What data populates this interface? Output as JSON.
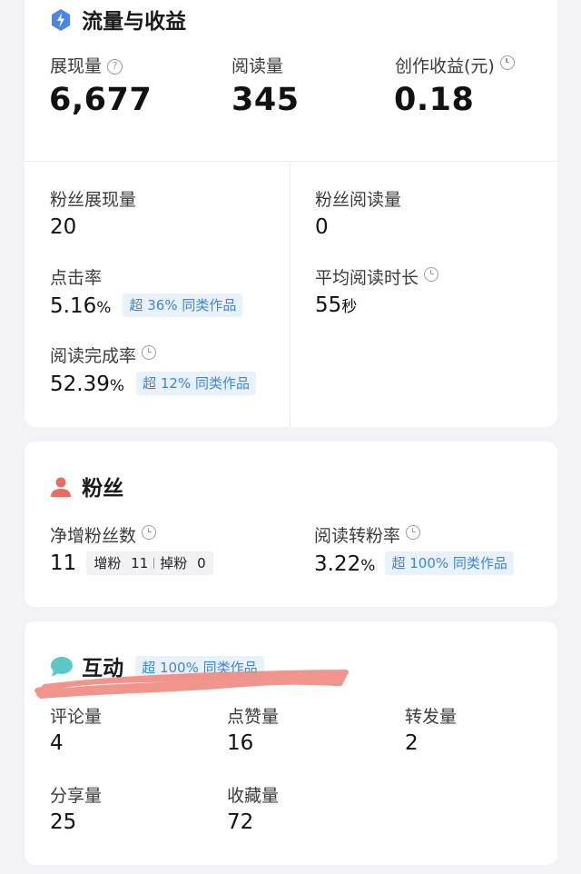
{
  "traffic": {
    "title": "流量与收益",
    "impressions": {
      "label": "展现量",
      "value": "6,677"
    },
    "reads": {
      "label": "阅读量",
      "value": "345"
    },
    "earnings": {
      "label": "创作收益(元)",
      "value": "0.18"
    },
    "fan_impressions": {
      "label": "粉丝展现量",
      "value": "20"
    },
    "fan_reads": {
      "label": "粉丝阅读量",
      "value": "0"
    },
    "ctr": {
      "label": "点击率",
      "value": "5.16",
      "unit": "%",
      "tag": "超 36% 同类作品"
    },
    "avg_read_time": {
      "label": "平均阅读时长",
      "value": "55",
      "unit": "秒"
    },
    "completion": {
      "label": "阅读完成率",
      "value": "52.39",
      "unit": "%",
      "tag": "超 12% 同类作品"
    }
  },
  "fans": {
    "title": "粉丝",
    "net_growth": {
      "label": "净增粉丝数",
      "value": "11",
      "gain_label": "增粉",
      "gain_value": "11",
      "loss_label": "掉粉",
      "loss_value": "0"
    },
    "conversion": {
      "label": "阅读转粉率",
      "value": "3.22",
      "unit": "%",
      "tag": "超 100% 同类作品"
    }
  },
  "interaction": {
    "title": "互动",
    "tag": "超 100% 同类作品",
    "comments": {
      "label": "评论量",
      "value": "4"
    },
    "likes": {
      "label": "点赞量",
      "value": "16"
    },
    "shares": {
      "label": "转发量",
      "value": "2"
    },
    "forwards": {
      "label": "分享量",
      "value": "25"
    },
    "favorites": {
      "label": "收藏量",
      "value": "72"
    }
  },
  "colors": {
    "accent_blue": "#3e86d5",
    "fans_icon": "#ea6a64",
    "interact_icon": "#5cc7c7",
    "scribble": "#f08a80"
  },
  "icons": [
    "lightning-icon",
    "help-icon",
    "clock-icon",
    "person-icon",
    "chat-bubble-icon"
  ]
}
